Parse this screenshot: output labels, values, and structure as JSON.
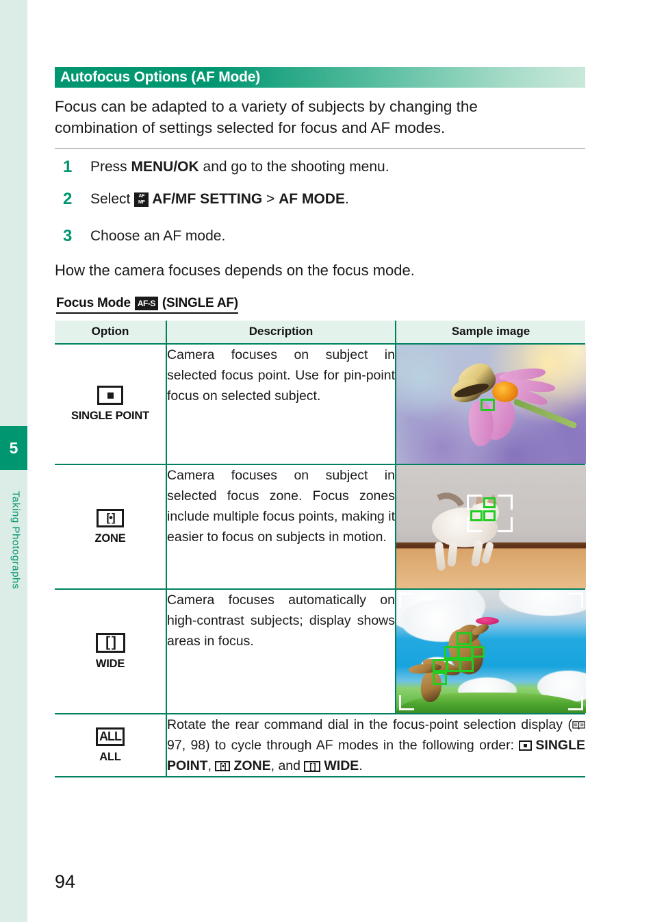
{
  "sidebar": {
    "chapter_number": "5",
    "chapter_title": "Taking Photographs"
  },
  "section": {
    "title": "Autofocus Options (AF Mode)",
    "intro_line_1": "Focus can be adapted to a variety of subjects by changing the",
    "intro_line_2": "combination of settings selected for focus and AF modes."
  },
  "steps": [
    {
      "number": "1",
      "text_before": "Press ",
      "bold": "MENU/OK",
      "text_after": " and go to the shooting menu."
    },
    {
      "number": "2",
      "text_before": "Select ",
      "icon": "af-mf-icon",
      "bold": "AF/MF SETTING",
      "separator": " > ",
      "bold2": "AF MODE",
      "text_after": "."
    },
    {
      "number": "3",
      "text_before": "Choose an AF mode.",
      "bold": "",
      "text_after": ""
    }
  ],
  "focus_note": "How the camera focuses depends on the focus mode.",
  "focus_mode_heading": {
    "label": "Focus Mode",
    "icon_text": "AF-S",
    "mode_name": "(SINGLE AF)"
  },
  "table": {
    "headers": {
      "option": "Option",
      "description": "Description",
      "sample": "Sample image"
    },
    "rows": [
      {
        "option_label": "SINGLE POINT",
        "option_icon": "single-point-icon",
        "description": "Camera focuses on subject in selected focus point. Use for pin-point focus on selected subject.",
        "sample_alt": "butterfly on purple coneflower with single green focus square"
      },
      {
        "option_label": "ZONE",
        "option_icon": "zone-icon",
        "description": "Camera focuses on subject in selected focus zone. Focus zones include multiple focus points, making it easier to focus on subjects in motion.",
        "sample_alt": "white kitten walking with zone brackets and three green focus squares"
      },
      {
        "option_label": "WIDE",
        "option_icon": "wide-icon",
        "description": "Camera focuses automatically on high-contrast subjects; display shows areas in focus.",
        "sample_alt": "dog leaping for pink frisbee against blue sky with wide-area green focus squares"
      },
      {
        "option_label": "ALL",
        "option_icon": "all-icon",
        "description_part_1": "Rotate the rear command dial in the focus-point selection display (",
        "page_refs": " 97, 98",
        "description_part_2": ") to cycle through AF modes in the following order: ",
        "mode_1": "SINGLE POINT",
        "mode_sep_1": ", ",
        "mode_2": "ZONE",
        "mode_sep_2": ", and ",
        "mode_3": "WIDE",
        "description_end": "."
      }
    ]
  },
  "page_number": "94",
  "colors": {
    "brand_green": "#009670",
    "table_border": "#008060",
    "header_row_bg": "#e4f2ec",
    "sidebar_bg": "#dcece6",
    "focus_square": "#22cc22"
  }
}
